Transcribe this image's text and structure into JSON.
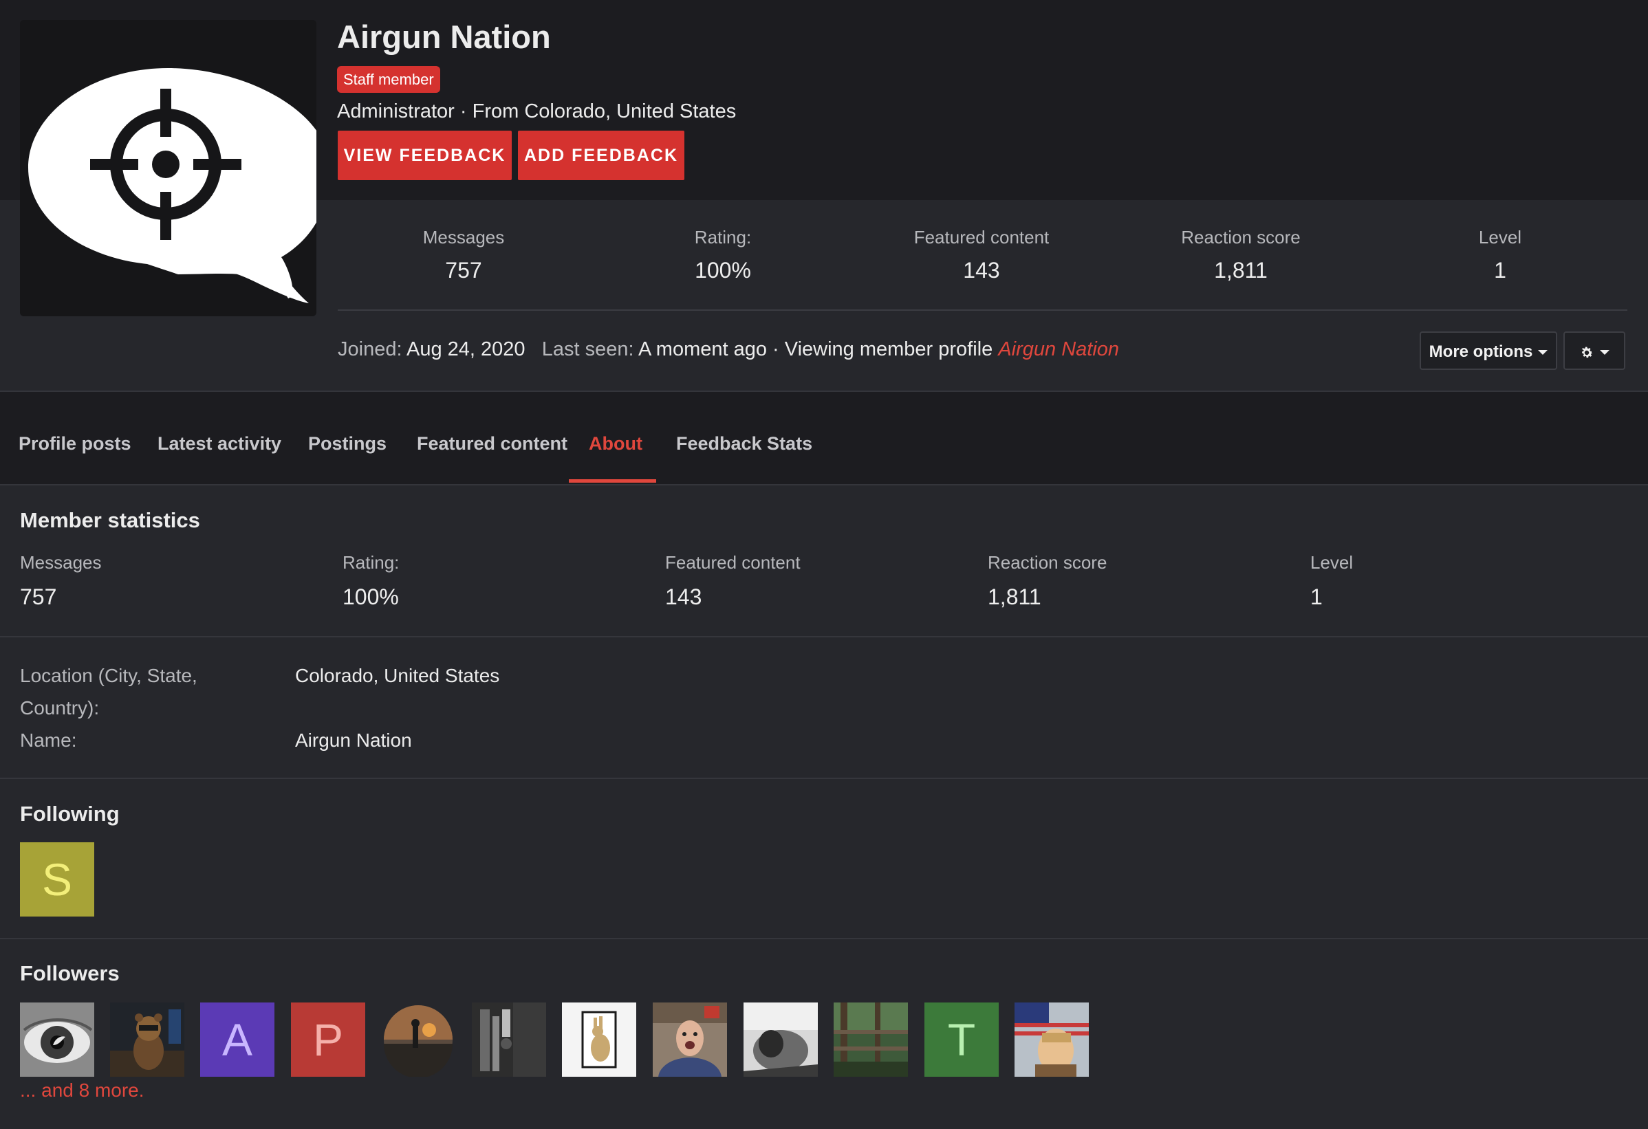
{
  "profile": {
    "name": "Airgun Nation",
    "badge": "Staff member",
    "info": "Administrator · From Colorado, United States",
    "view_feedback": "VIEW FEEDBACK",
    "add_feedback": "ADD FEEDBACK"
  },
  "stats": [
    {
      "label": "Messages",
      "value": "757"
    },
    {
      "label": "Rating:",
      "value": "100%"
    },
    {
      "label": "Featured content",
      "value": "143"
    },
    {
      "label": "Reaction score",
      "value": "1,811"
    },
    {
      "label": "Level",
      "value": "1"
    }
  ],
  "joined": {
    "joined_label": "Joined:",
    "joined_value": "Aug 24, 2020",
    "last_seen_label": "Last seen:",
    "last_seen_value": "A moment ago · Viewing member profile",
    "last_seen_link": "Airgun Nation"
  },
  "options": {
    "more": "More options"
  },
  "tabs": [
    {
      "label": "Profile posts"
    },
    {
      "label": "Latest activity"
    },
    {
      "label": "Postings"
    },
    {
      "label": "Featured content"
    },
    {
      "label": "About"
    },
    {
      "label": "Feedback Stats"
    }
  ],
  "member_statistics": {
    "title": "Member statistics",
    "items": [
      {
        "label": "Messages",
        "value": "757"
      },
      {
        "label": "Rating:",
        "value": "100%"
      },
      {
        "label": "Featured content",
        "value": "143"
      },
      {
        "label": "Reaction score",
        "value": "1,811"
      },
      {
        "label": "Level",
        "value": "1"
      }
    ]
  },
  "about": {
    "location_label_1": "Location (City, State,",
    "location_label_2": "Country):",
    "location_value": "Colorado, United States",
    "name_label": "Name:",
    "name_value": "Airgun Nation"
  },
  "following": {
    "title": "Following",
    "avatars": [
      {
        "letter": "S",
        "bg": "#a7a337",
        "fg": "#f3ef7a"
      }
    ]
  },
  "followers": {
    "title": "Followers",
    "letters": [
      {
        "letter": "A",
        "bg": "#5b3ab5",
        "fg": "#c9b6ff"
      },
      {
        "letter": "P",
        "bg": "#b83a35",
        "fg": "#f5b0aa"
      },
      {
        "letter": "T",
        "bg": "#3c7a3a",
        "fg": "#b8f0b0"
      }
    ],
    "more_text": "... and 8 more."
  },
  "colors": {
    "accent": "#d5322f",
    "link": "#e0473d",
    "background": "#1c1c20",
    "panel": "#26272c"
  },
  "icons": {
    "avatar": "crosshair-speech-bubble-icon",
    "gear": "gear-icon",
    "dropdown": "caret-down-icon"
  }
}
